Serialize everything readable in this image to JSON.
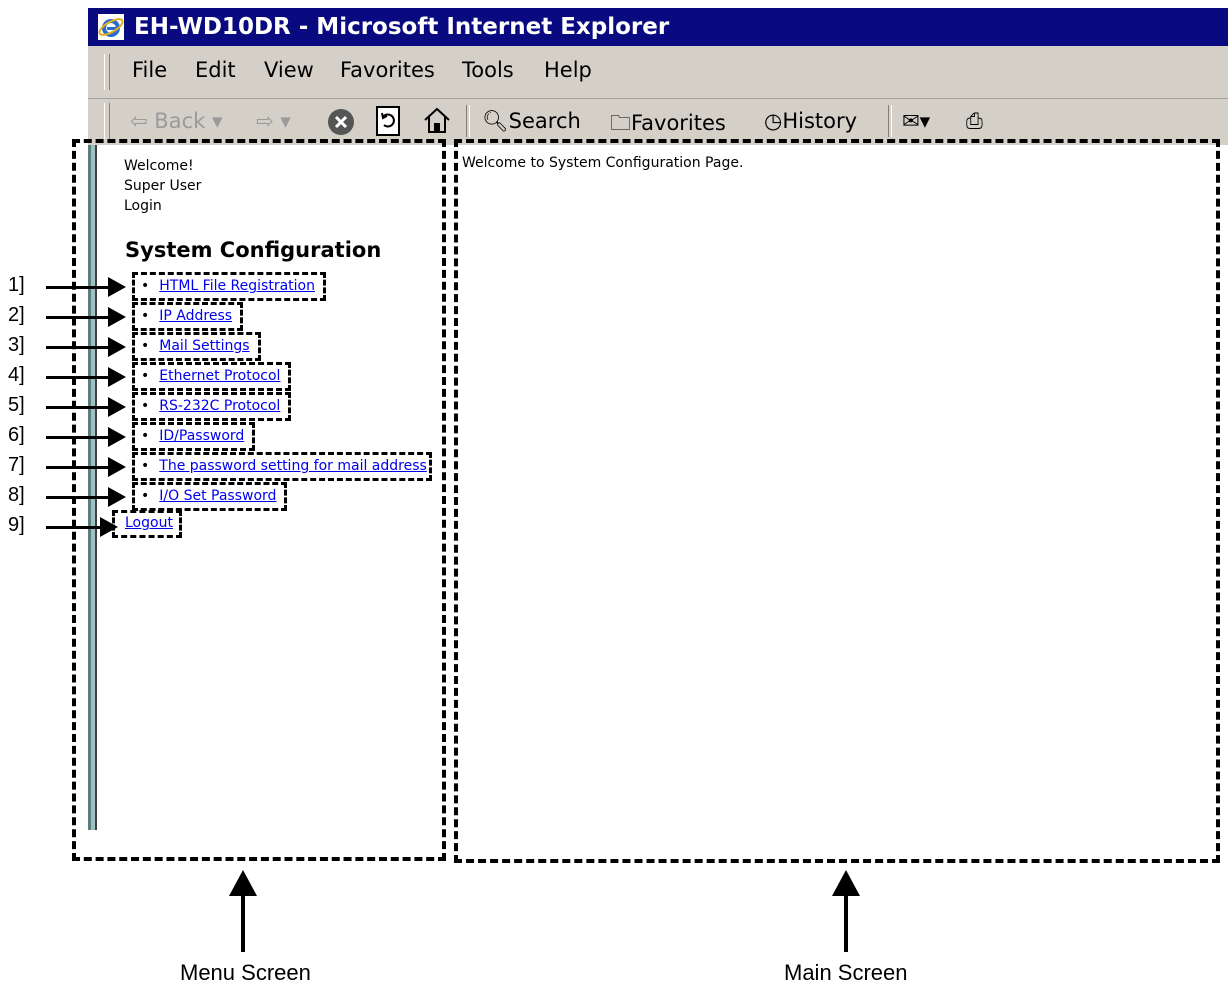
{
  "window": {
    "title": "EH-WD10DR - Microsoft Internet Explorer"
  },
  "menubar": [
    "File",
    "Edit",
    "View",
    "Favorites",
    "Tools",
    "Help"
  ],
  "toolbar": {
    "back": "Back",
    "search": "Search",
    "favorites": "Favorites",
    "history": "History"
  },
  "menu_frame": {
    "welcome": "Welcome!",
    "user": "Super User",
    "login": "Login",
    "heading": "System Configuration",
    "bullet": "•",
    "links": [
      "HTML File Registration",
      "IP Address",
      "Mail Settings",
      "Ethernet Protocol",
      "RS-232C Protocol",
      "ID/Password",
      "The password setting for mail address",
      "I/O Set Password"
    ],
    "logout": "Logout"
  },
  "main_frame": {
    "message": "Welcome to System Configuration Page."
  },
  "callouts": [
    "1]",
    "2]",
    "3]",
    "4]",
    "5]",
    "6]",
    "7]",
    "8]",
    "9]"
  ],
  "captions": {
    "menu": "Menu Screen",
    "main": "Main Screen"
  }
}
